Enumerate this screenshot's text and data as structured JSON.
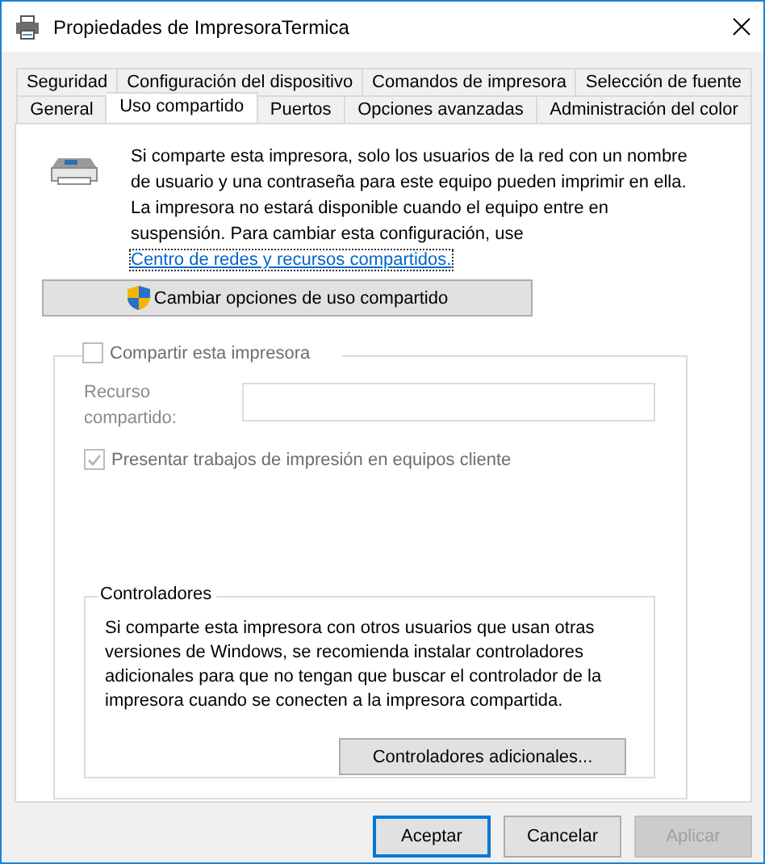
{
  "window": {
    "title": "Propiedades de ImpresoraTermica"
  },
  "tab_rows": [
    {
      "tabs": [
        {
          "label": "Seguridad",
          "selected": false
        },
        {
          "label": "Configuración del dispositivo",
          "selected": false
        },
        {
          "label": "Comandos de impresora",
          "selected": false
        },
        {
          "label": "Selección de fuente",
          "selected": false
        }
      ]
    },
    {
      "tabs": [
        {
          "label": "General",
          "selected": false
        },
        {
          "label": "Uso compartido",
          "selected": true
        },
        {
          "label": "Puertos",
          "selected": false
        },
        {
          "label": "Opciones avanzadas",
          "selected": false
        },
        {
          "label": "Administración del color",
          "selected": false
        }
      ]
    }
  ],
  "sharing": {
    "description": "Si comparte esta impresora, solo los usuarios de la red con un nombre de usuario y una contraseña para este equipo pueden imprimir en ella. La impresora no estará disponible cuando el equipo entre en suspensión. Para cambiar esta configuración, use",
    "link": "Centro de redes y recursos compartidos.",
    "change_button": "Cambiar opciones de uso compartido"
  },
  "share_group": {
    "share_checkbox": {
      "label": "Compartir esta impresora",
      "checked": false,
      "disabled": true
    },
    "share_name": {
      "label": "Recurso compartido:",
      "disabled": true
    },
    "render_checkbox": {
      "label": "Presentar trabajos de impresión en equipos cliente",
      "checked": true,
      "disabled": true
    }
  },
  "drivers": {
    "title": "Controladores",
    "text": "Si comparte esta impresora con otros usuarios que usan otras versiones de Windows, se recomienda instalar controladores adicionales para que no tengan que buscar el controlador de la impresora cuando se conecten a la impresora compartida.",
    "button": "Controladores adicionales..."
  },
  "buttons": [
    {
      "label": "Aceptar",
      "kind": "default"
    },
    {
      "label": "Cancelar",
      "kind": "normal"
    },
    {
      "label": "Aplicar",
      "kind": "disabled"
    }
  ]
}
